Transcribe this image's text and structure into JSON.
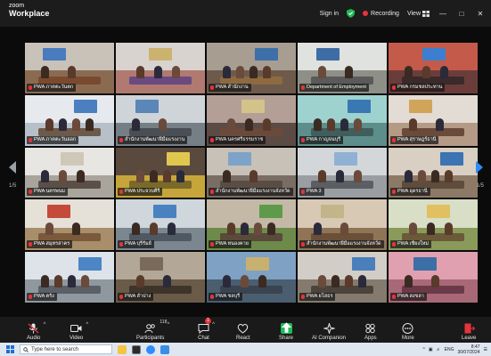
{
  "app": {
    "brand_top": "zoom",
    "brand_bottom": "Workplace"
  },
  "titlebar": {
    "signin": "Sign in",
    "recording": "Recording",
    "view": "View",
    "accent": "#1fb955",
    "record_color": "#e5343a"
  },
  "grid": {
    "tiles": [
      {
        "name": "PWA ภาคตะวันตก",
        "wall": "#c9c2b8",
        "floor": "#8a6b52",
        "table": "#7a4a2f",
        "screen": "#4a7bbf"
      },
      {
        "name": "",
        "wall": "#d9d3cf",
        "floor": "#b07a70",
        "table": "#6a4a80",
        "screen": "#cbb36f"
      },
      {
        "name": "PWA สำนักงาน",
        "wall": "#a89d91",
        "floor": "#6e5a4a",
        "table": "#8d6a42",
        "screen": "#3d6fa8"
      },
      {
        "name": "Department of Employment",
        "wall": "#dfe2de",
        "floor": "#8e8f86",
        "table": "#5a5a5a",
        "screen": "#3e6da6"
      },
      {
        "name": "PWA กรมชลประทาน",
        "wall": "#c45a4a",
        "floor": "#6b3d3a",
        "table": "#3a2a2a",
        "screen": "#3c7fd0"
      },
      {
        "name": "PWA ภาคตะวันออก",
        "wall": "#e6eaee",
        "floor": "#b7bfc9",
        "table": "#6d5a4a",
        "screen": "#4b7fc0"
      },
      {
        "name": "สำนักงานพัฒนาฝีมือแรงงาน",
        "wall": "#cfd4d8",
        "floor": "#777f86",
        "table": "#4a4f55",
        "screen": "#5a86b8"
      },
      {
        "name": "PWA นครศรีธรรมราช",
        "wall": "#b39f96",
        "floor": "#5c4a44",
        "table": "#6a4a3a",
        "screen": "#d3c38a"
      },
      {
        "name": "PWA กาญจนบุรี",
        "wall": "#9ed2cf",
        "floor": "#5e8e8b",
        "table": "#3f5e5c",
        "screen": "#3a78b4"
      },
      {
        "name": "PWA สุราษฎร์ธานี",
        "wall": "#e3dcd4",
        "floor": "#b59a86",
        "table": "#6a4a3a",
        "screen": "#d0a55a"
      },
      {
        "name": "PWA นครพนม",
        "wall": "#e8e6e2",
        "floor": "#a9a49c",
        "table": "#5a5048",
        "screen": "#cfc8b8"
      },
      {
        "name": "PWA ประจวบคีรี",
        "wall": "#5a4a3e",
        "floor": "#c6a63a",
        "table": "#7a6a2a",
        "screen": "#e0c850"
      },
      {
        "name": "สำนักงานพัฒนาฝีมือแรงงานจังหวัด",
        "wall": "#c8c1b8",
        "floor": "#7a6e64",
        "table": "#5a4e44",
        "screen": "#7ea3c8"
      },
      {
        "name": "PWA 3",
        "wall": "#d4d7da",
        "floor": "#9a9ea3",
        "table": "#5b5f63",
        "screen": "#8fb1d4"
      },
      {
        "name": "PWA อุดรธานี",
        "wall": "#d9cfc2",
        "floor": "#8c7a66",
        "table": "#5e4c3c",
        "screen": "#3b73b3"
      },
      {
        "name": "PWA สมุทรสาคร",
        "wall": "#e6e1d8",
        "floor": "#a88e6a",
        "table": "#7a5a3a",
        "screen": "#c44a3a"
      },
      {
        "name": "PWA บุรีรัมย์",
        "wall": "#cfd6dc",
        "floor": "#7b868f",
        "table": "#4e5963",
        "screen": "#4a82c0"
      },
      {
        "name": "PWA หนองคาย",
        "wall": "#c4b9a6",
        "floor": "#6d8a4a",
        "table": "#5a4a3a",
        "screen": "#5d9a4a"
      },
      {
        "name": "สำนักงานพัฒนาฝีมือแรงงานจังหวัด",
        "wall": "#d8c9b5",
        "floor": "#8f7456",
        "table": "#6a5038",
        "screen": "#c3b58a"
      },
      {
        "name": "PWA เชียงใหม่",
        "wall": "#d8dfc6",
        "floor": "#8a9a5a",
        "table": "#6a5a3a",
        "screen": "#e0c060"
      },
      {
        "name": "PWA ตรัง",
        "wall": "#dde3e8",
        "floor": "#8f989f",
        "table": "#5a6066",
        "screen": "#4c86c4"
      },
      {
        "name": "PWA ลำปาง",
        "wall": "#b3a898",
        "floor": "#6a5a48",
        "table": "#3e342a",
        "screen": "#7a6a5a"
      },
      {
        "name": "PWA ชลบุรี",
        "wall": "#7fa1c4",
        "floor": "#4a5e70",
        "table": "#3a4450",
        "screen": "#c8b070"
      },
      {
        "name": "PWA ยโสธร",
        "wall": "#d2cdc6",
        "floor": "#857a6e",
        "table": "#4c443c",
        "screen": "#4a7fbb"
      },
      {
        "name": "PWA สงขลา",
        "wall": "#e0a0b0",
        "floor": "#a86878",
        "table": "#6a3a48",
        "screen": "#3b6fa5"
      }
    ],
    "active_index": 3,
    "page_left": "1/5",
    "page_right": "1/5"
  },
  "toolbar": {
    "audio": "Audio",
    "video": "Video",
    "participants": "Participants",
    "participants_count": "118",
    "chat": "Chat",
    "chat_badge": "1",
    "react": "React",
    "share": "Share",
    "ai_companion": "AI Companion",
    "apps": "Apps",
    "more": "More",
    "leave": "Leave"
  },
  "taskbar": {
    "search_placeholder": "Type here to search",
    "lang": "ENG",
    "time": "8:47",
    "date": "30/07/2024"
  }
}
